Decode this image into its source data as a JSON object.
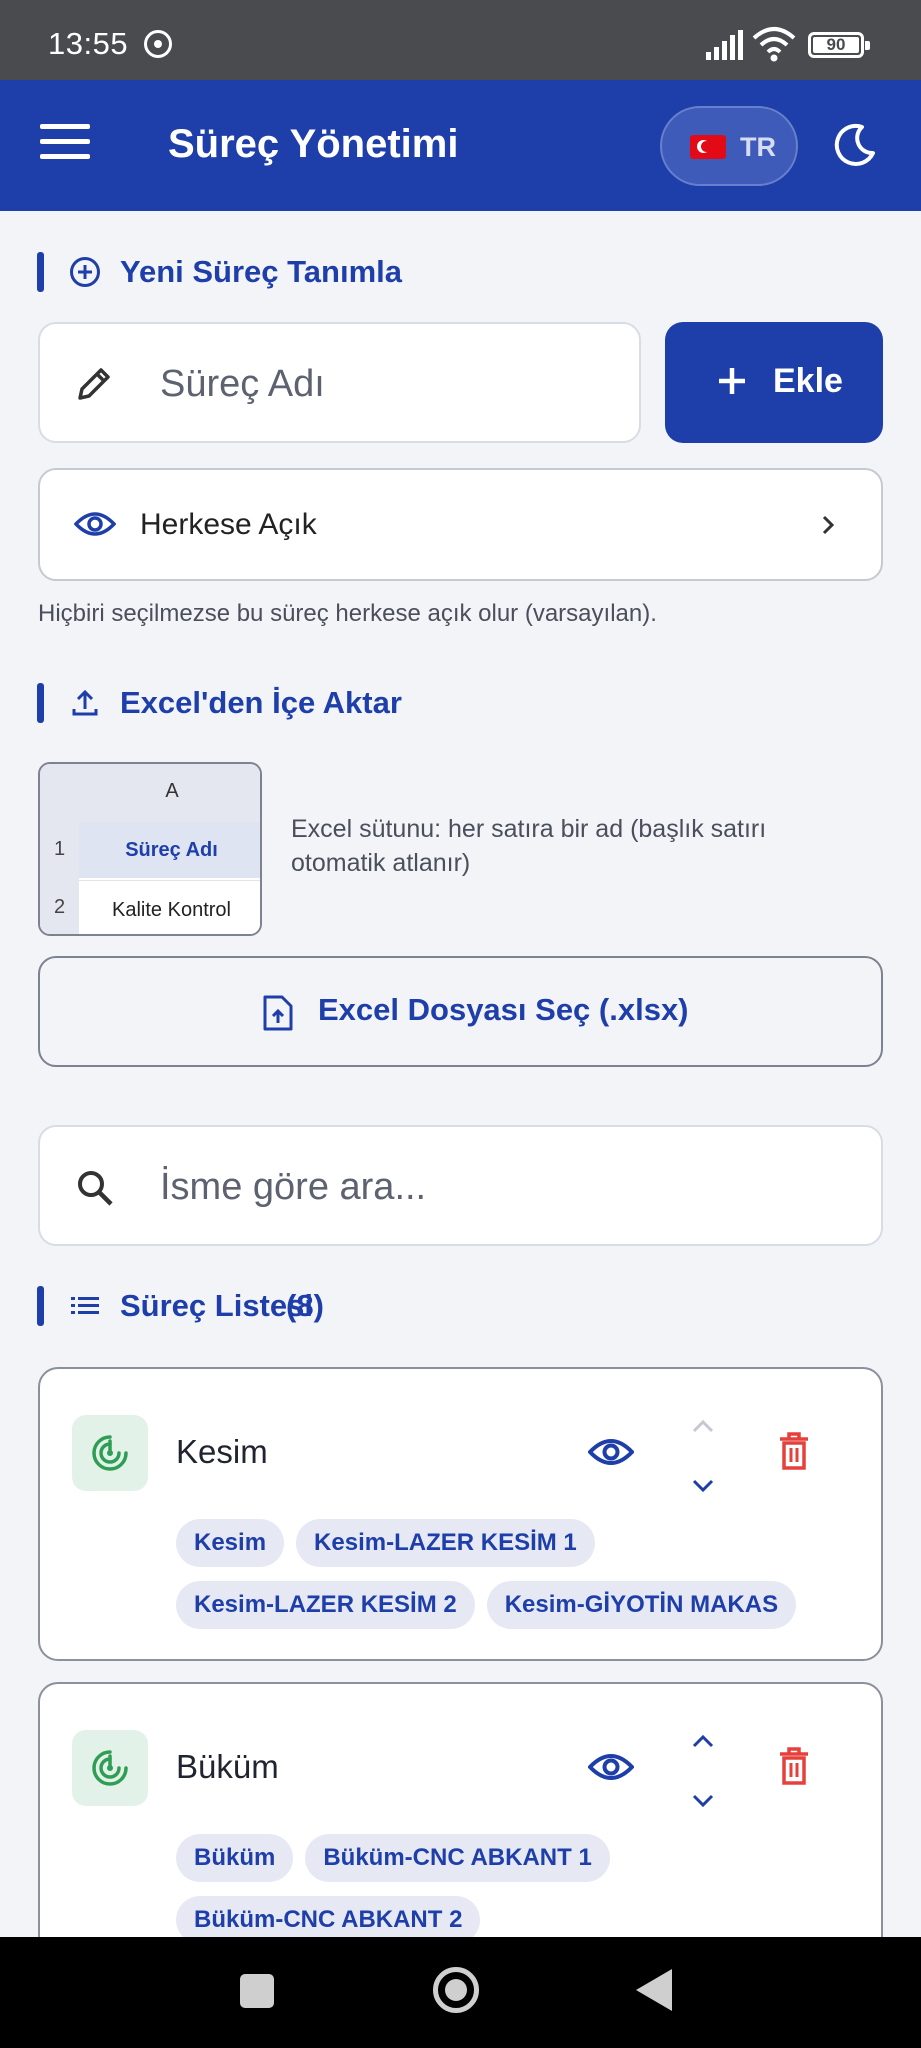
{
  "status_bar": {
    "time": "13:55",
    "battery": "90"
  },
  "app_bar": {
    "title": "Süreç Yönetimi",
    "language": "TR"
  },
  "new_process": {
    "section_title": "Yeni Süreç Tanımla",
    "name_placeholder": "Süreç Adı",
    "add_label": "Ekle",
    "visibility_label": "Herkese Açık",
    "hint": "Hiçbiri seçilmezse bu süreç herkese açık olur (varsayılan)."
  },
  "excel_import": {
    "section_title": "Excel'den İçe Aktar",
    "preview": {
      "column_header": "A",
      "rows": [
        {
          "num": "1",
          "value": "Süreç Adı"
        },
        {
          "num": "2",
          "value": "Kalite Kontrol"
        }
      ]
    },
    "description": "Excel sütunu: her satıra bir ad (başlık satırı otomatik atlanır)",
    "file_button": "Excel Dosyası Seç (.xlsx)"
  },
  "search": {
    "placeholder": "İsme göre ara..."
  },
  "process_list": {
    "section_title": "Süreç Listesi",
    "count": "(8)",
    "items": [
      {
        "name": "Kesim",
        "tags": [
          "Kesim",
          "Kesim-LAZER KESİM 1",
          "Kesim-LAZER KESİM 2",
          "Kesim-GİYOTİN MAKAS"
        ]
      },
      {
        "name": "Büküm",
        "tags": [
          "Büküm",
          "Büküm-CNC ABKANT 1",
          "Büküm-CNC ABKANT 2"
        ]
      }
    ]
  },
  "colors": {
    "primary": "#1e3faa",
    "danger": "#e5403b",
    "success": "#2e9e55",
    "background": "#f3f4f8"
  }
}
